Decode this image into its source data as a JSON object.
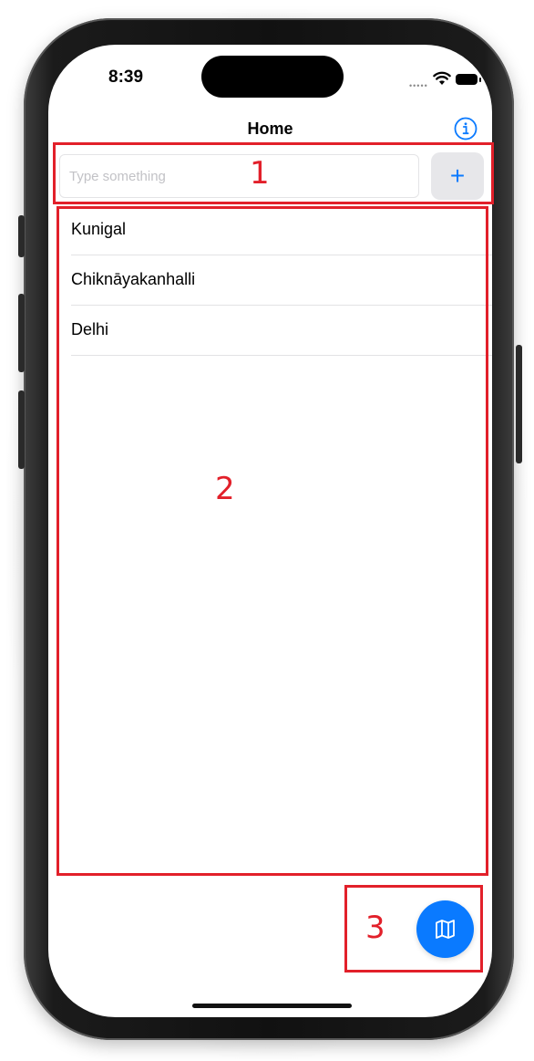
{
  "status_bar": {
    "time": "8:39",
    "signal_icon": "signal-dots-icon",
    "wifi_icon": "wifi-icon",
    "battery_icon": "battery-icon"
  },
  "nav": {
    "title": "Home",
    "info_icon": "info-circle-icon"
  },
  "input": {
    "placeholder": "Type something",
    "value": "",
    "add_label": "+"
  },
  "list": {
    "items": [
      {
        "label": "Kunigal"
      },
      {
        "label": "Chiknāyakanhalli"
      },
      {
        "label": "Delhi"
      }
    ]
  },
  "fab": {
    "icon": "map-icon"
  },
  "annotations": {
    "box1": "1",
    "box2": "2",
    "box3": "3"
  },
  "colors": {
    "accent": "#0a7aff",
    "annotation": "#e2202a"
  }
}
